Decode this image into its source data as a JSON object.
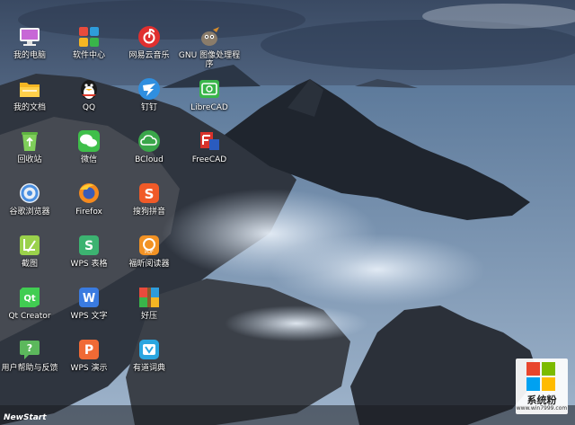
{
  "desktop": {
    "icons": [
      {
        "label": "我的电脑"
      },
      {
        "label": "软件中心"
      },
      {
        "label": "网易云音乐"
      },
      {
        "label": "GNU 图像处理程序"
      },
      {
        "label": "我的文档"
      },
      {
        "label": "QQ"
      },
      {
        "label": "钉钉"
      },
      {
        "label": "LibreCAD"
      },
      {
        "label": "回收站"
      },
      {
        "label": "微信"
      },
      {
        "label": "BCloud"
      },
      {
        "label": "FreeCAD"
      },
      {
        "label": "谷歌浏览器"
      },
      {
        "label": "Firefox"
      },
      {
        "label": "搜狗拼音"
      },
      {
        "label": "截图"
      },
      {
        "label": "WPS 表格"
      },
      {
        "label": "福昕阅读器"
      },
      {
        "label": "Qt Creator"
      },
      {
        "label": "WPS 文字"
      },
      {
        "label": "好压"
      },
      {
        "label": "用户帮助与反馈"
      },
      {
        "label": "WPS 演示"
      },
      {
        "label": "有道词典"
      }
    ]
  },
  "taskbar": {
    "start_label": "NewStart"
  },
  "watermark": {
    "title": "系统粉",
    "url": "www.win7999.com"
  }
}
